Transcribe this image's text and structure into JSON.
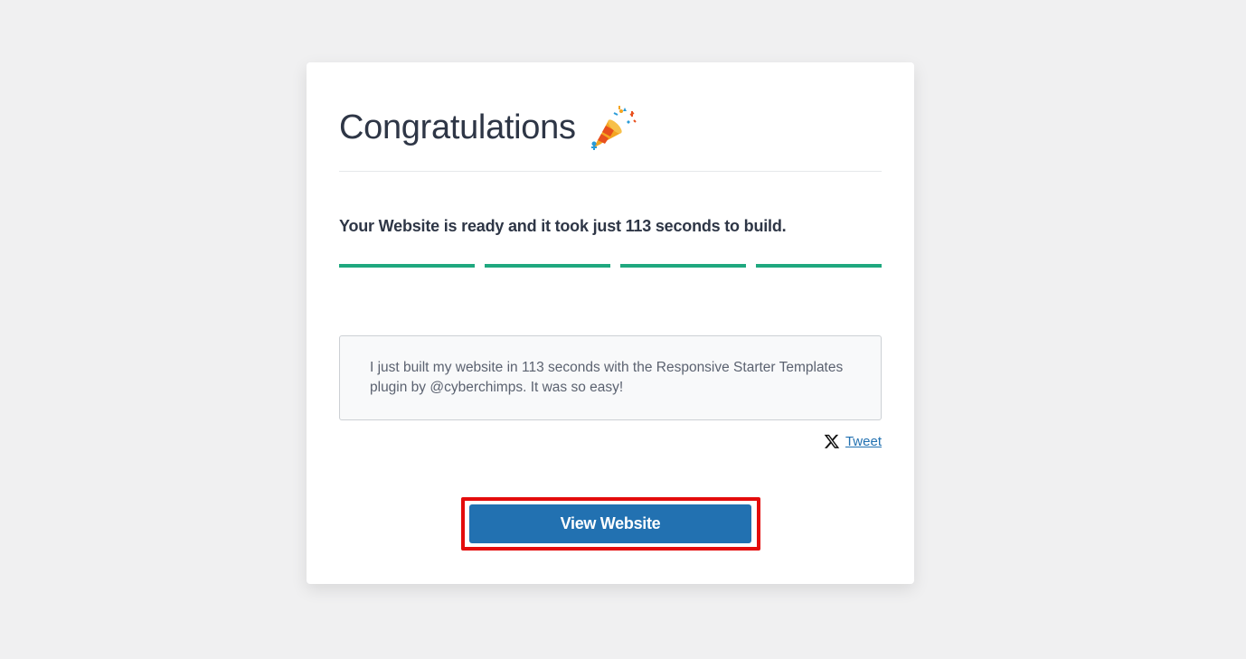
{
  "card": {
    "title": "Congratulations",
    "title_icon": "party-popper-icon",
    "message": "Your Website is ready and it took just 113 seconds to build.",
    "progress": {
      "steps_total": 4,
      "steps_completed": 4,
      "color": "#1fa87f"
    },
    "tweet_text": "I just built my website in 113 seconds with the Responsive Starter Templates plugin by @cyberchimps. It was so easy!",
    "tweet_icon": "x-logo-icon",
    "tweet_link_label": "Tweet",
    "view_button_label": "View Website"
  },
  "colors": {
    "accent": "#2271b1",
    "progress": "#1fa87f",
    "highlight": "#e40c0c",
    "background": "#f0f0f1"
  }
}
